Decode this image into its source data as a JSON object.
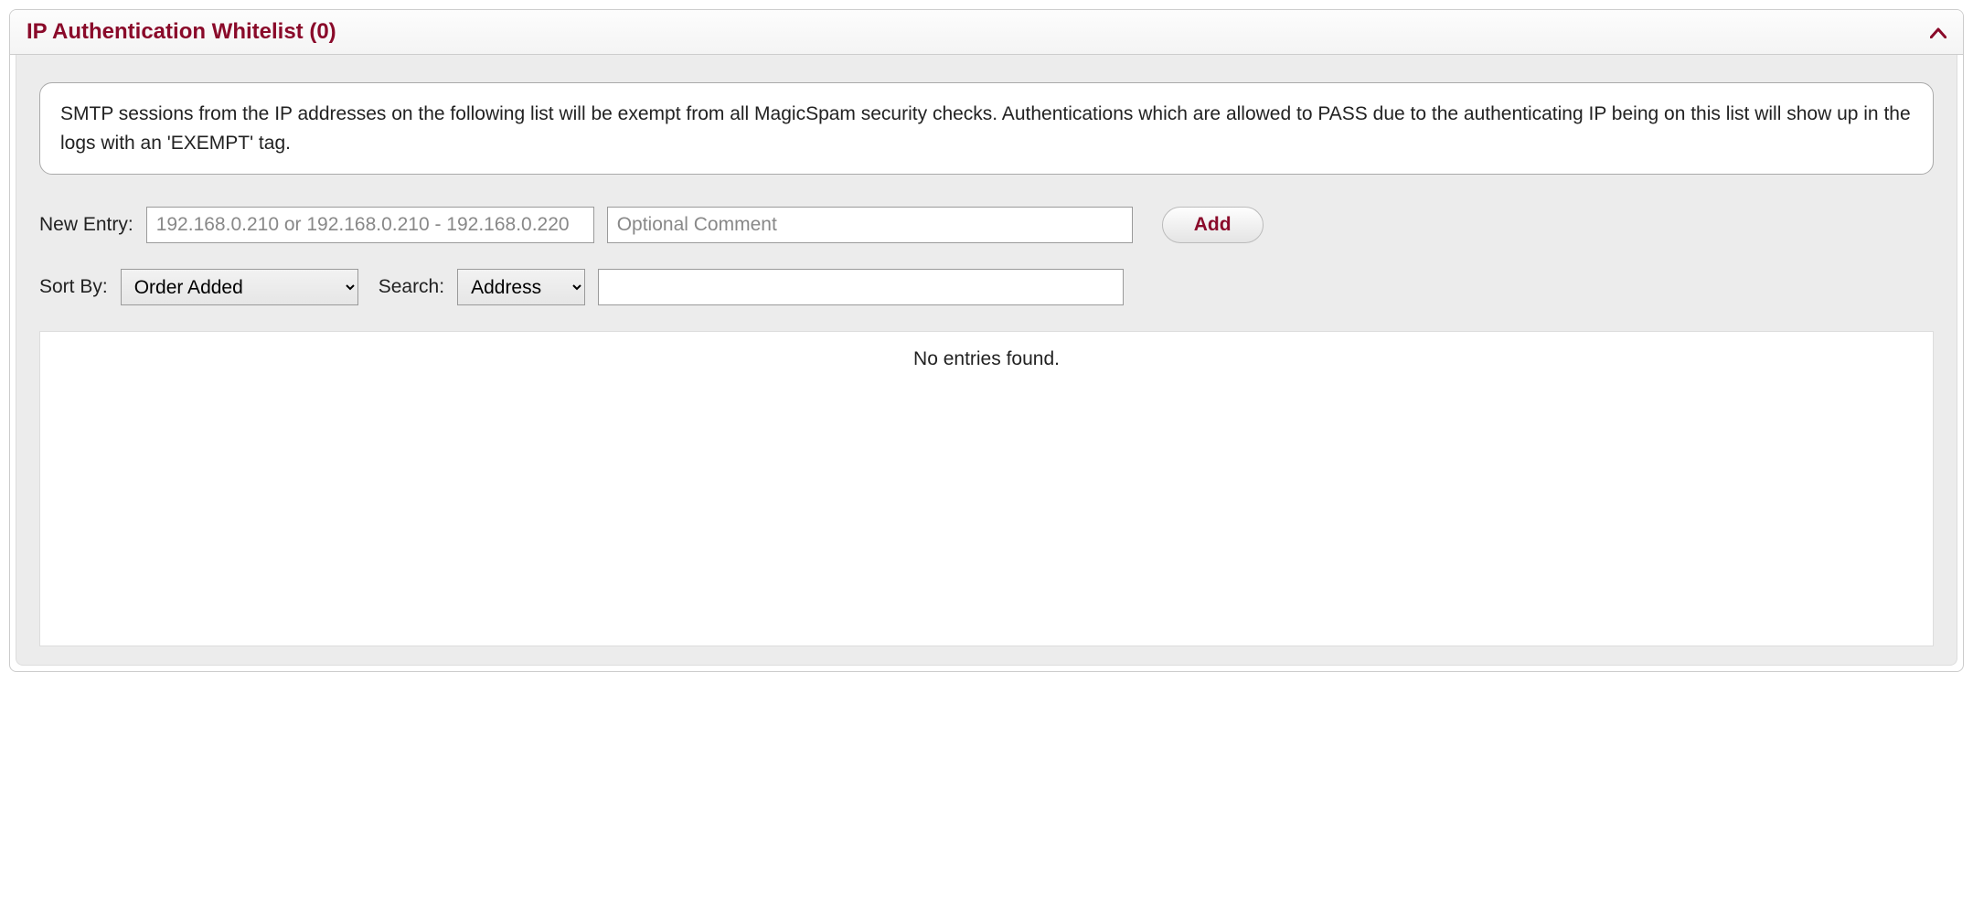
{
  "panel": {
    "title": "IP Authentication Whitelist (0)",
    "description": "SMTP sessions from the IP addresses on the following list will be exempt from all MagicSpam security checks. Authentications which are allowed to PASS due to the authenticating IP being on this list will show up in the logs with an 'EXEMPT' tag."
  },
  "form": {
    "new_entry_label": "New Entry:",
    "ip_placeholder": "192.168.0.210 or 192.168.0.210 - 192.168.0.220",
    "comment_placeholder": "Optional Comment",
    "add_label": "Add",
    "sort_by_label": "Sort By:",
    "sort_by_value": "Order Added",
    "search_label": "Search:",
    "search_type_value": "Address",
    "search_value": ""
  },
  "results": {
    "empty_message": "No entries found."
  }
}
